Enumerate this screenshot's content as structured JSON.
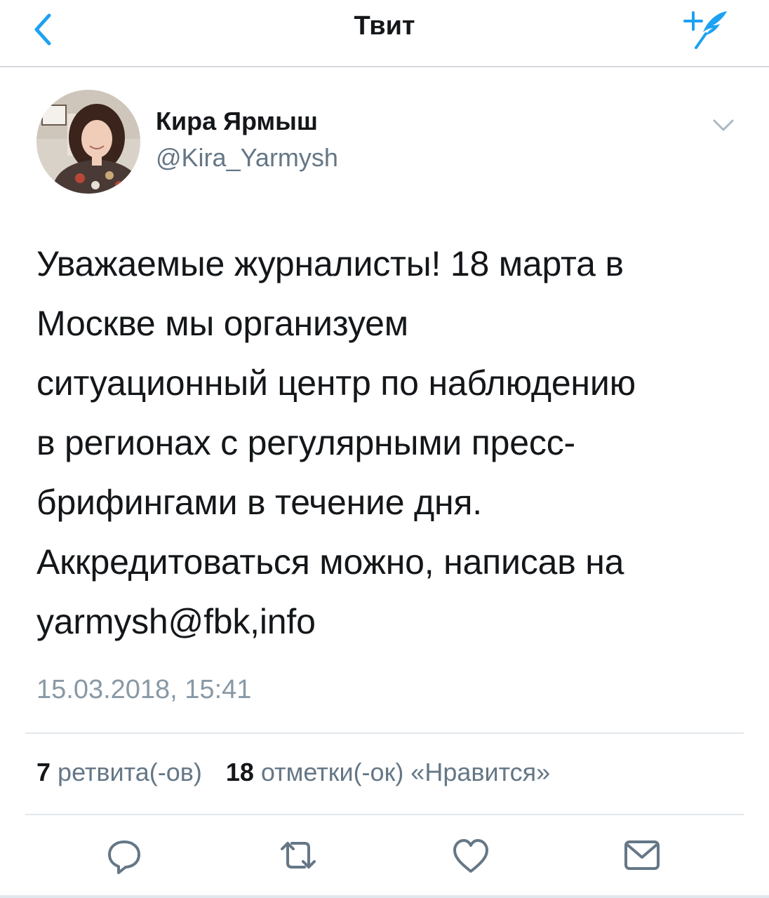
{
  "navbar": {
    "title": "Твит",
    "back_icon": "chevron-left-icon",
    "compose_icon": "compose-tweet-icon"
  },
  "author": {
    "name": "Кира Ярмыш",
    "handle": "@Kira_Yarmysh",
    "avatar_icon": "profile-avatar"
  },
  "tweet": {
    "lines": [
      "Уважаемые журналисты! 18 марта в",
      "Москве мы организуем",
      "ситуационный центр по наблюдению",
      "в регионах с регулярными пресс-",
      "брифингами в течение дня.",
      "Аккредитоваться можно, написав на",
      "yarmysh@fbk,info"
    ],
    "timestamp": "15.03.2018, 15:41"
  },
  "stats": {
    "retweets_count": "7",
    "retweets_label": "ретвита(-ов)",
    "likes_count": "18",
    "likes_label": "отметки(-ок) «Нравится»"
  },
  "actions": [
    {
      "icon": "reply-icon"
    },
    {
      "icon": "retweet-icon"
    },
    {
      "icon": "heart-icon"
    },
    {
      "icon": "envelope-icon"
    }
  ],
  "colors": {
    "accent": "#1da1f2",
    "text": "#14171a",
    "secondary": "#657786",
    "muted": "#8899a6",
    "divider": "#e1e8ed"
  }
}
